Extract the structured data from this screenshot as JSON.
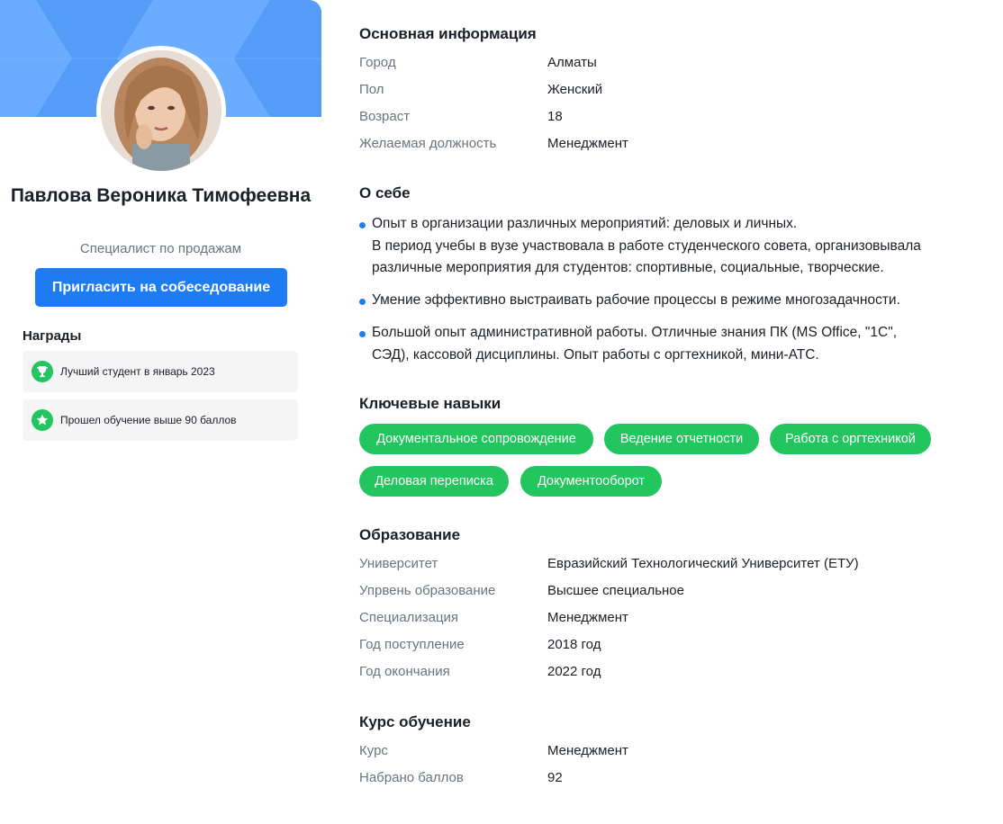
{
  "profile": {
    "name": "Павлова Вероника Тимофеевна",
    "role": "Специалист по продажам",
    "invite_label": "Пригласить на собеседование"
  },
  "awards": {
    "title": "Награды",
    "items": [
      {
        "icon": "trophy-icon",
        "label": "Лучший студент в январь 2023"
      },
      {
        "icon": "star-icon",
        "label": "Прошел обучение выше 90 баллов"
      }
    ]
  },
  "basic": {
    "title": "Основная информация",
    "rows": [
      {
        "key": "Город",
        "value": "Алматы"
      },
      {
        "key": "Пол",
        "value": "Женский"
      },
      {
        "key": "Возраст",
        "value": "18"
      },
      {
        "key": "Желаемая должность",
        "value": "Менеджмент"
      }
    ]
  },
  "about": {
    "title": "О себе",
    "items": [
      "Опыт в организации различных мероприятий: деловых и личных.\nВ период учебы в вузе участвовала в работе студенческого совета, организовывала\nразличные мероприятия для студентов: спортивные, социальные, творческие.",
      "Умение эффективно выстраивать рабочие процессы в режиме многозадачности.",
      "Большой опыт административной работы. Отличные знания ПК (MS Office, \"1С\",\nСЭД), кассовой дисциплины. Опыт работы с оргтехникой, мини-АТС."
    ]
  },
  "skills": {
    "title": "Ключевые навыки",
    "items": [
      "Документальное сопровождение",
      "Ведение отчетности",
      "Работа с оргтехникой",
      "Деловая переписка",
      "Документооборот"
    ]
  },
  "education": {
    "title": "Образование",
    "rows": [
      {
        "key": "Университет",
        "value": "Евразийский Технологический Университет (ЕТУ)"
      },
      {
        "key": "Упрвень образование",
        "value": "Высшее специальное"
      },
      {
        "key": "Специализация",
        "value": "Менеджмент"
      },
      {
        "key": "Год поступление",
        "value": "2018 год"
      },
      {
        "key": "Год окончания",
        "value": "2022 год"
      }
    ]
  },
  "course": {
    "title": "Курс обучение",
    "rows": [
      {
        "key": "Курс",
        "value": "Менеджмент"
      },
      {
        "key": "Набрано баллов",
        "value": "92"
      }
    ]
  },
  "colors": {
    "accent": "#1e7cf2",
    "chip": "#22c55e",
    "banner": "#5ea4ff"
  }
}
